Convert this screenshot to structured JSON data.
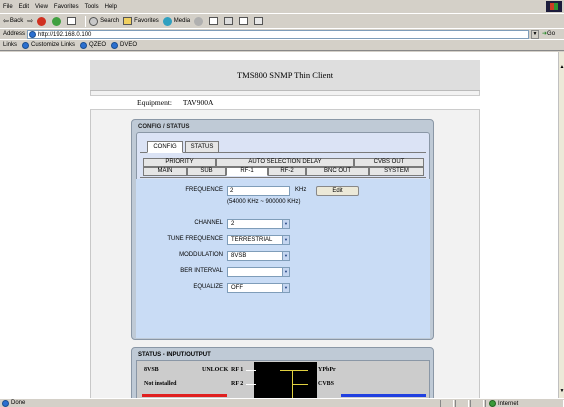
{
  "menubar": {
    "items": [
      "File",
      "Edit",
      "View",
      "Favorites",
      "Tools",
      "Help"
    ]
  },
  "toolbar": {
    "back_label": "Back",
    "search_label": "Search",
    "favorites_label": "Favorites",
    "media_label": "Media"
  },
  "address": {
    "label": "Address",
    "url": "http://192.168.0.100",
    "go_label": "Go"
  },
  "links": {
    "label": "Links",
    "items": [
      "Customize Links",
      "QZEO",
      "DVEO"
    ]
  },
  "page": {
    "title": "TMS800 SNMP Thin Client",
    "equipment_label": "Equipment:",
    "equipment_value": "TAV900A"
  },
  "config": {
    "header": "CONFIG / STATUS",
    "tabs_top": [
      "CONFIG",
      "STATUS"
    ],
    "tabs_row2": [
      "PRIORITY",
      "AUTO SELECTION DELAY",
      "CVBS OUT"
    ],
    "tabs_row3": [
      "MAIN",
      "SUB",
      "RF-1",
      "RF-2",
      "BNC OUT",
      "SYSTEM"
    ],
    "frequence_label": "FREQUENCE",
    "frequence_value": "2",
    "frequence_unit": "KHz",
    "edit_label": "Edit",
    "frequence_range": "(54000 KHz ~ 900000 KHz)",
    "channel_label": "CHANNEL",
    "channel_value": "2",
    "tune_label": "TUNE FREQUENCE",
    "tune_value": "TERRESTRIAL",
    "modulation_label": "MODDULATION",
    "modulation_value": "8VSB",
    "ber_label": "BER INTERVAL",
    "ber_value": "",
    "equalize_label": "EQUALIZE",
    "equalize_value": "OFF"
  },
  "status_io": {
    "header": "STATUS - INPUT/OUTPUT",
    "mode": "8VSB",
    "lock": "UNLOCK",
    "rf1": "RF 1",
    "rf2": "RF 2",
    "not_installed": "Not installed",
    "out1": "YPbPr",
    "out2": "CVBS"
  },
  "statusbar": {
    "text": "Done",
    "zone": "Internet"
  }
}
